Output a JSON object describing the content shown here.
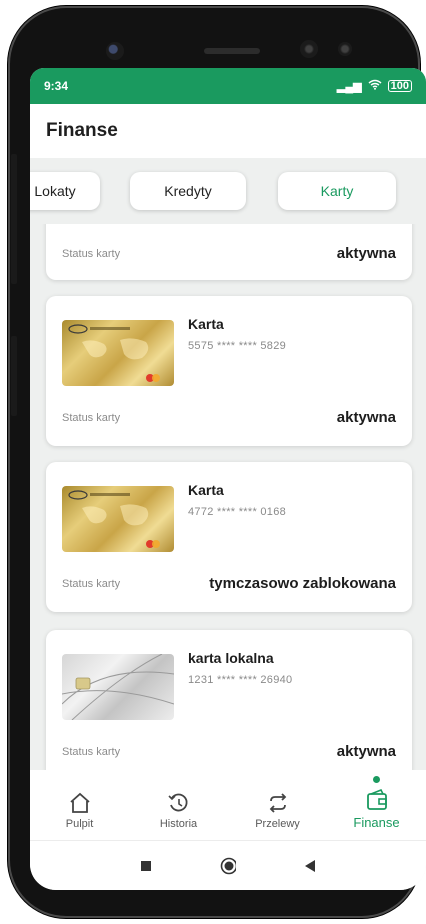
{
  "statusbar": {
    "time": "9:34",
    "battery": "100"
  },
  "appbar": {
    "title": "Finanse"
  },
  "tabs": [
    {
      "label": "Lokaty"
    },
    {
      "label": "Kredyty"
    },
    {
      "label": "Karty",
      "active": true
    }
  ],
  "cards": [
    {
      "status_label": "Status karty",
      "status_value": "aktywna"
    },
    {
      "name": "Karta",
      "number": "5575 **** **** 5829",
      "image": "gold-card-icon",
      "status_label": "Status karty",
      "status_value": "aktywna"
    },
    {
      "name": "Karta",
      "number": "4772 **** **** 0168",
      "image": "gold-card-icon",
      "status_label": "Status karty",
      "status_value": "tymczasowo zablokowana"
    },
    {
      "name": "karta lokalna",
      "number": "1231 **** **** 26940",
      "image": "gray-card-icon",
      "status_label": "Status karty",
      "status_value": "aktywna"
    }
  ],
  "bottomnav": [
    {
      "label": "Pulpit",
      "icon": "home-icon"
    },
    {
      "label": "Historia",
      "icon": "history-icon"
    },
    {
      "label": "Przelewy",
      "icon": "transfer-icon"
    },
    {
      "label": "Finanse",
      "icon": "wallet-icon",
      "active": true
    }
  ],
  "colors": {
    "accent": "#1a9a5f"
  }
}
